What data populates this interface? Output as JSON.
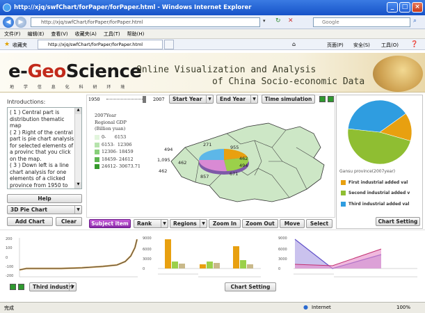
{
  "window": {
    "title": "http://xjq/swfChart/forPaper/forPaper.html - Windows Internet Explorer",
    "controls": [
      "_",
      "□",
      "×"
    ]
  },
  "address": {
    "url": "http://xjq/swfChart/forPaper/forPaper.html",
    "search_placeholder": "Google"
  },
  "menu": {
    "items": [
      "文件(F)",
      "编辑(E)",
      "查看(V)",
      "收藏夹(A)",
      "工具(T)",
      "帮助(H)"
    ]
  },
  "favorites": {
    "label": "收藏夹",
    "tab_title": "http://xjq/swfChart/forPaper/forPaper.html",
    "toolbar_items": [
      "页面(P)",
      "安全(S)",
      "工具(O)"
    ]
  },
  "header": {
    "logo_e": "e-",
    "logo_geo": "Geo",
    "logo_science": "Science",
    "logo_sub": "地 学 信 息 化 科 研 环 境",
    "title_line1": "Online Visualization and Analysis",
    "title_line2": "of China Socio-economic Data"
  },
  "intro": {
    "label": "Introductions:",
    "text": "( 1 ) Central part is distribution thematic map\n( 2 ) Right of the central part is pie chart analysis for selected elements of a provinc that you click on the map.\n( 3 ) Down left is a line chart analysis for one elements of a clicked province from 1950 to"
  },
  "left_controls": {
    "help": "Help",
    "chart_type": "3D Pie Chart",
    "add_chart": "Add Chart",
    "clear": "Clear"
  },
  "map": {
    "year_start": "1950",
    "year_end": "2007",
    "start_year_btn": "Start Year",
    "end_year_btn": "End Year",
    "time_simulation": "Time simulation",
    "legend_title_1": "2007Year",
    "legend_title_2": "Regional GDP",
    "legend_title_3": "(Billion yuan)",
    "legend": [
      {
        "range": "0-      6153",
        "color": "#e2f5dd"
      },
      {
        "range": "6153-  12306",
        "color": "#b6e3ac"
      },
      {
        "range": "12306- 18459",
        "color": "#88cf7a"
      },
      {
        "range": "18459- 24612",
        "color": "#5eb651"
      },
      {
        "range": "24612- 30673.71",
        "color": "#369a2c"
      }
    ],
    "labels": [
      "271",
      "494",
      "955",
      "462",
      "494",
      "462",
      "1,095",
      "462",
      "857",
      "671"
    ],
    "bottom_buttons": [
      "Subject item",
      "Rank",
      "Regions",
      "Zoom In",
      "Zoom Out",
      "Move",
      "Select"
    ]
  },
  "right_panel": {
    "province_title": "Gansu province(2007year)",
    "pie": [
      {
        "name": "First industrial added val",
        "value": 14.3,
        "color": "#e8a010"
      },
      {
        "name": "Second industrial added v",
        "value": 47.3,
        "color": "#8fbe32"
      },
      {
        "name": "Third industrial added val",
        "value": 38.4,
        "color": "#2f9de0"
      }
    ],
    "chart_setting": "Chart Setting"
  },
  "bottom": {
    "line_ticks": [
      "200",
      "100",
      "0",
      "-100",
      "-200"
    ],
    "bar_ticks": [
      "9000",
      "6000",
      "3000",
      "0"
    ],
    "area_ticks": [
      "9000",
      "6000",
      "3000",
      "0"
    ],
    "series_select": "Third industri",
    "chart_setting": "Chart Setting"
  },
  "status": {
    "left": "完成",
    "zone": "Internet",
    "zoom": "100%"
  }
}
